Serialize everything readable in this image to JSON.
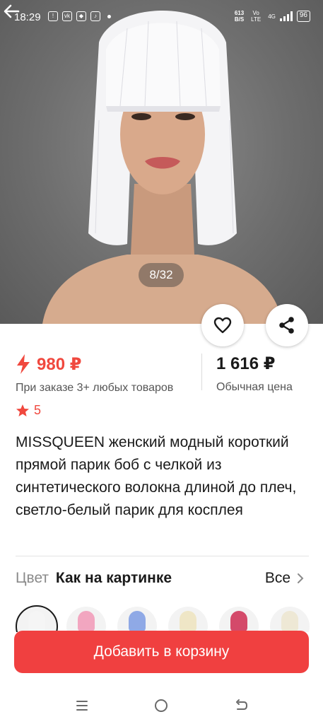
{
  "status_bar": {
    "time": "18:29",
    "net_speed_value": "613",
    "net_speed_unit": "B/S",
    "volte": "Vo LTE",
    "network": "4G",
    "battery": "96"
  },
  "gallery": {
    "counter": "8/32"
  },
  "price": {
    "promo_price": "980 ₽",
    "promo_note": "При заказе 3+ любых товаров",
    "regular_price": "1 616 ₽",
    "regular_note": "Обычная цена"
  },
  "rating": {
    "value": "5"
  },
  "product": {
    "title": "MISSQUEEN женский модный короткий прямой парик боб с челкой из синтетического волокна длиной до плеч, светло-белый парик для косплея"
  },
  "color": {
    "label": "Цвет",
    "value": "Как на картинке",
    "all_label": "Все"
  },
  "swatch_colors": [
    "#f5f5f5",
    "#f2a6c0",
    "#8fa9e6",
    "#efe6c6",
    "#d44a6a",
    "#eee8d5"
  ],
  "cart": {
    "button_label": "Добавить в корзину"
  },
  "colors": {
    "accent": "#f04040",
    "price_red": "#f0483e",
    "muted_text": "#8a8a8a"
  }
}
